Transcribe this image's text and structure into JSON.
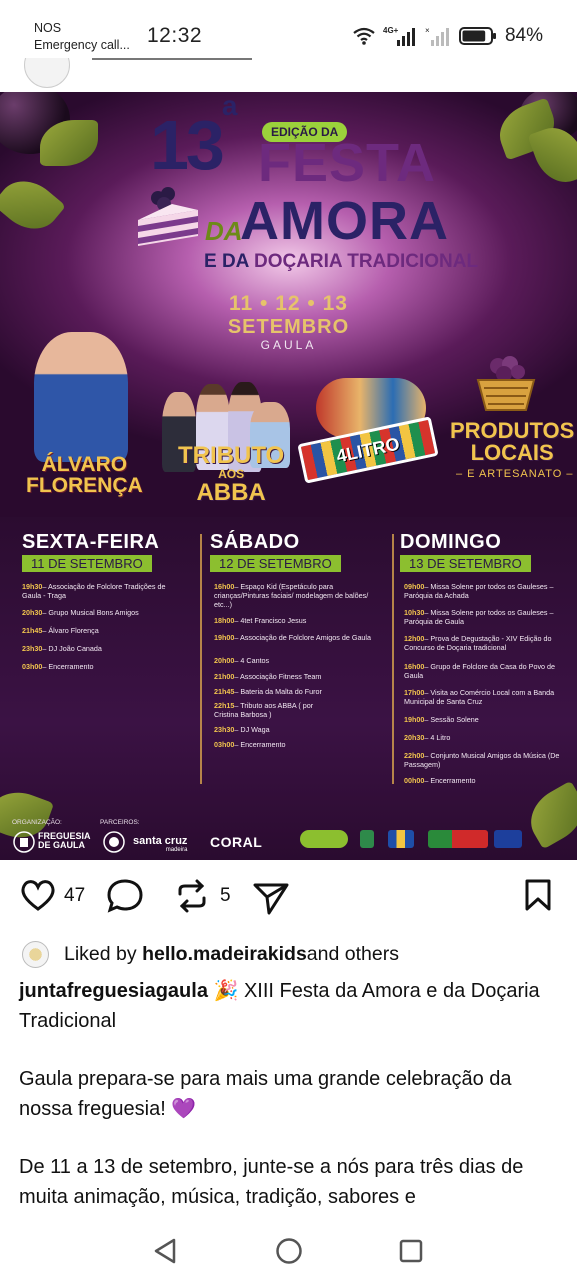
{
  "status_bar": {
    "carrier": "NOS",
    "carrier_sub": "Emergency call...",
    "time": "12:32",
    "network": "4G+",
    "battery": "84%",
    "battery_level": 0.84
  },
  "poster": {
    "edition_badge": "EDIÇÃO DA",
    "edition_number": "13",
    "edition_suffix": "a",
    "title_festa": "FESTA",
    "title_da": "DA",
    "title_amora": "AMORA",
    "subtitle_prefix": "E DA",
    "subtitle_main": "DOÇARIA TRADICIONAL",
    "dates": "11 • 12 • 13",
    "month": "SETEMBRO",
    "place": "GAULA",
    "artists": {
      "alvaro_line1": "ÁLVARO",
      "alvaro_line2": "FLORENÇA",
      "tributo": "TRIBUTO",
      "aos": "AOS",
      "abba": "ABBA",
      "litro": "4LITRO",
      "produtos": "PRODUTOS",
      "locais": "LOCAIS",
      "artesanato": "– E ARTESANATO –"
    },
    "days": [
      {
        "title": "SEXTA-FEIRA",
        "date": "11 DE SETEMBRO",
        "events": [
          {
            "time": "19h30",
            "text": "– Associação de Folclore Tradições de Gaula - Traga"
          },
          {
            "time": "20h30",
            "text": "– Grupo Musical Bons Amigos"
          },
          {
            "time": "21h45",
            "text": "– Álvaro Florença"
          },
          {
            "time": "23h30",
            "text": "– DJ João Canada"
          },
          {
            "time": "03h00",
            "text": "– Encerramento"
          }
        ]
      },
      {
        "title": "SÁBADO",
        "date": "12 DE SETEMBRO",
        "events": [
          {
            "time": "16h00",
            "text": "– Espaço Kid (Espetáculo para crianças/Pinturas faciais/ modelagem de balões/ etc...)"
          },
          {
            "time": "18h00",
            "text": "– 4tet Francisco Jesus"
          },
          {
            "time": "19h00",
            "text": "– Associação de Folclore Amigos de Gaula"
          },
          {
            "time": "20h00",
            "text": "– 4 Cantos"
          },
          {
            "time": "21h00",
            "text": "– Associação Fitness Team"
          },
          {
            "time": "21h45",
            "text": "– Bateria da Malta do Furor"
          },
          {
            "time": "22h15",
            "text": "– Tributo aos ABBA ( por Cristina Barbosa )"
          },
          {
            "time": "23h30",
            "text": "– DJ Waga"
          },
          {
            "time": "03h00",
            "text": "– Encerramento"
          }
        ]
      },
      {
        "title": "DOMINGO",
        "date": "13 DE SETEMBRO",
        "events": [
          {
            "time": "09h00",
            "text": "– Missa Solene por todos os Gauleses – Paróquia da Achada"
          },
          {
            "time": "10h30",
            "text": "– Missa Solene por todos os Gauleses – Paróquia de Gaula"
          },
          {
            "time": "12h00",
            "text": "– Prova de Degustação - XIV Edição do Concurso de Doçaria tradicional"
          },
          {
            "time": "16h00",
            "text": "– Grupo de Folclore da Casa do Povo de Gaula"
          },
          {
            "time": "17h00",
            "text": "– Visita ao Comércio Local com a Banda Municipal de Santa Cruz"
          },
          {
            "time": "19h00",
            "text": "– Sessão Solene"
          },
          {
            "time": "20h30",
            "text": "– 4 Litro"
          },
          {
            "time": "22h00",
            "text": "– Conjunto Musical Amigos da Música (De Passagem)"
          },
          {
            "time": "00h00",
            "text": "– Encerramento"
          }
        ]
      }
    ],
    "footer": {
      "organizacao": "ORGANIZAÇÃO:",
      "parceiros": "PARCEIROS:",
      "freguesia_1": "FREGUESIA",
      "freguesia_2": "DE GAULA",
      "santa_cruz": "santa cruz",
      "madeira": "madeira",
      "coral": "CORAL"
    }
  },
  "post": {
    "like_count": "47",
    "repost_count": "5",
    "liked_by_prefix": "Liked by ",
    "liked_by_user": "hello.madeirakids",
    "liked_by_suffix": " and others",
    "username": "juntafreguesiagaula",
    "caption_emoji": "🎉",
    "caption_title": " XIII Festa da Amora e da Doçaria Tradicional",
    "paragraph_1": "Gaula prepara-se para mais uma grande celebração da nossa freguesia! 💜",
    "paragraph_2": "De 11 a 13 de setembro, junte-se a nós para três dias de muita animação, música, tradição, sabores e"
  }
}
